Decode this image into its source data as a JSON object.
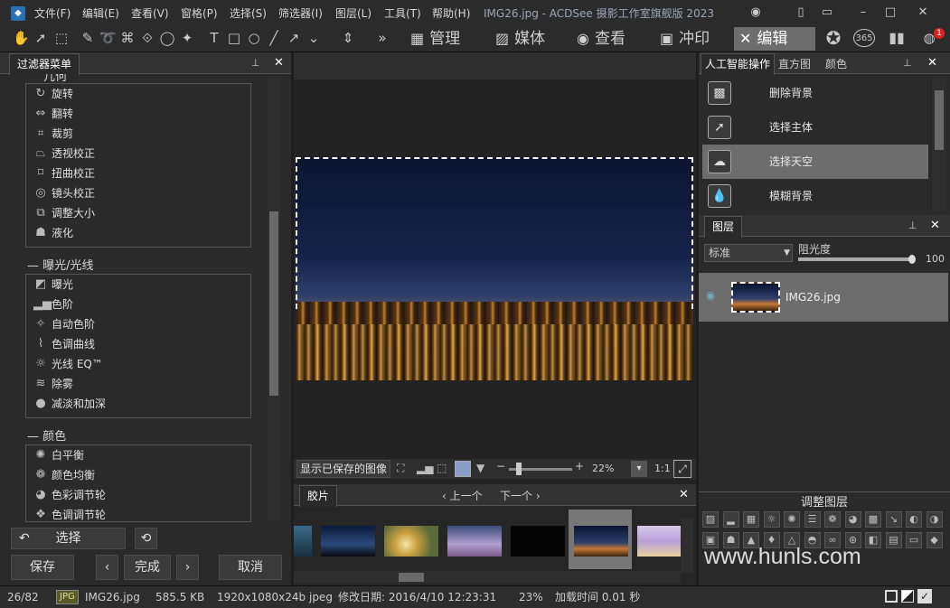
{
  "title": "IMG26.jpg - ACDSee 摄影工作室旗舰版 2023",
  "menu": [
    "文件(F)",
    "编辑(E)",
    "查看(V)",
    "窗格(P)",
    "选择(S)",
    "筛选器(I)",
    "图层(L)",
    "工具(T)",
    "帮助(H)"
  ],
  "modes": {
    "manage": "管理",
    "media": "媒体",
    "view": "查看",
    "print": "冲印",
    "edit": "编辑"
  },
  "left": {
    "tab": "过滤器菜单",
    "geometry_title": "几何",
    "geometry_items": [
      "旋转",
      "翻转",
      "裁剪",
      "透视校正",
      "扭曲校正",
      "镜头校正",
      "调整大小",
      "液化"
    ],
    "exposure_title": "曝光/光线",
    "exposure_items": [
      "曝光",
      "色阶",
      "自动色阶",
      "色调曲线",
      "光线 EQ™",
      "除雾",
      "减淡和加深"
    ],
    "color_title": "颜色",
    "color_items": [
      "白平衡",
      "颜色均衡",
      "色彩调节轮",
      "色调调节轮"
    ],
    "btn_select": "选择",
    "btn_save": "保存",
    "btn_done": "完成",
    "btn_cancel": "取消"
  },
  "center": {
    "show_saved": "显示已保存的图像",
    "zoom": "22%",
    "ratio": "1:1",
    "film_tab": "胶片",
    "prev": "上一个",
    "next": "下一个"
  },
  "right": {
    "tabs": [
      "人工智能操作",
      "直方图",
      "颜色"
    ],
    "ai_items": [
      "删除背景",
      "选择主体",
      "选择天空",
      "模糊背景"
    ],
    "layers_tab": "图层",
    "blend_mode": "标准",
    "opacity_label": "阻光度",
    "opacity_value": "100",
    "opacity": 1.0,
    "layer_name": "IMG26.jpg",
    "adj_title": "调整图层",
    "watermark": "www.hunls.com"
  },
  "status": {
    "index": "26/82",
    "type": "JPG",
    "file": "IMG26.jpg",
    "size": "585.5 KB",
    "dims": "1920x1080x24b jpeg",
    "modified": "修改日期: 2016/4/10 12:23:31",
    "zoom": "23%",
    "load": "加载时间 0.01 秒"
  },
  "notification_count": "1",
  "colors": {
    "accent": "#2a6fb3",
    "selected": "#6d6d6d"
  }
}
